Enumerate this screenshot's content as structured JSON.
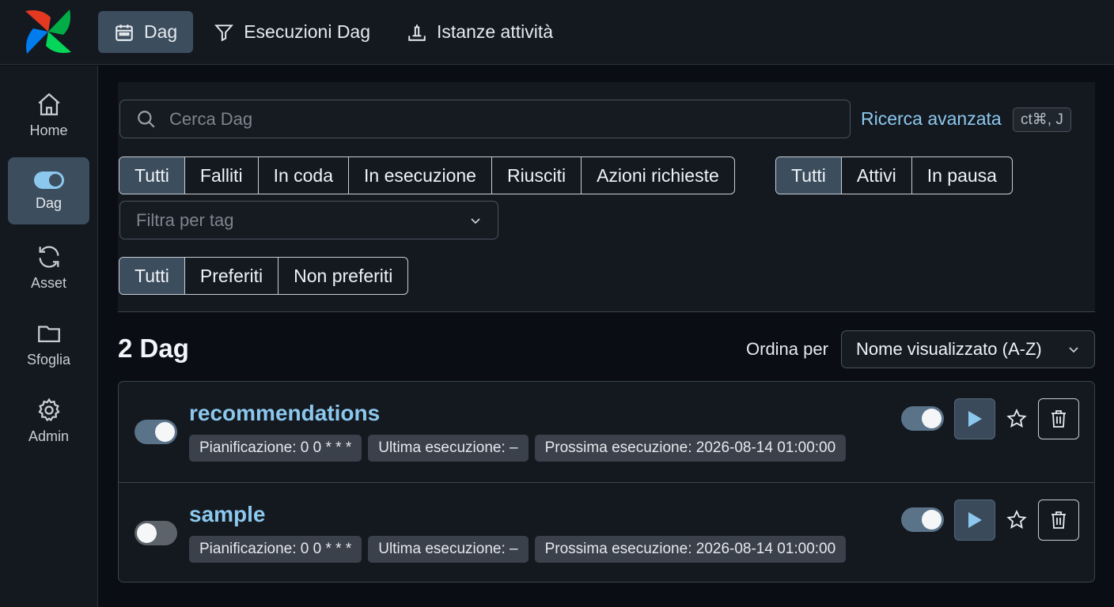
{
  "topnav": {
    "items": [
      {
        "label": "Dag",
        "icon": "calendar-icon",
        "active": true
      },
      {
        "label": "Esecuzioni Dag",
        "icon": "filter-icon",
        "active": false
      },
      {
        "label": "Istanze attività",
        "icon": "task-instance-icon",
        "active": false
      }
    ]
  },
  "sidebar": {
    "items": [
      {
        "label": "Home",
        "icon": "home-icon"
      },
      {
        "label": "Dag",
        "icon": "toggle-icon",
        "active": true
      },
      {
        "label": "Asset",
        "icon": "refresh-icon"
      },
      {
        "label": "Sfoglia",
        "icon": "folder-icon"
      },
      {
        "label": "Admin",
        "icon": "gear-icon"
      }
    ]
  },
  "search": {
    "placeholder": "Cerca Dag",
    "advanced_label": "Ricerca avanzata",
    "shortcut": "ct⌘, J"
  },
  "filters": {
    "status": [
      "Tutti",
      "Falliti",
      "In coda",
      "In esecuzione",
      "Riusciti",
      "Azioni richieste"
    ],
    "state": [
      "Tutti",
      "Attivi",
      "In pausa"
    ],
    "tag_placeholder": "Filtra per tag",
    "favorites": [
      "Tutti",
      "Preferiti",
      "Non preferiti"
    ]
  },
  "list": {
    "count_label": "2 Dag",
    "sort_label": "Ordina per",
    "sort_value": "Nome visualizzato (A-Z)",
    "dags": [
      {
        "name": "recommendations",
        "enabled": true,
        "schedule": "Pianificazione: 0 0 * * *",
        "last_run": "Ultima esecuzione: –",
        "next_run": "Prossima esecuzione: 2026-08-14 01:00:00"
      },
      {
        "name": "sample",
        "enabled": false,
        "schedule": "Pianificazione: 0 0 * * *",
        "last_run": "Ultima esecuzione: –",
        "next_run": "Prossima esecuzione: 2026-08-14 01:00:00"
      }
    ]
  },
  "colors": {
    "accent": "#8cc8ee",
    "selected": "#3c4d5e",
    "background": "#0a0e14",
    "panel": "#141920"
  }
}
